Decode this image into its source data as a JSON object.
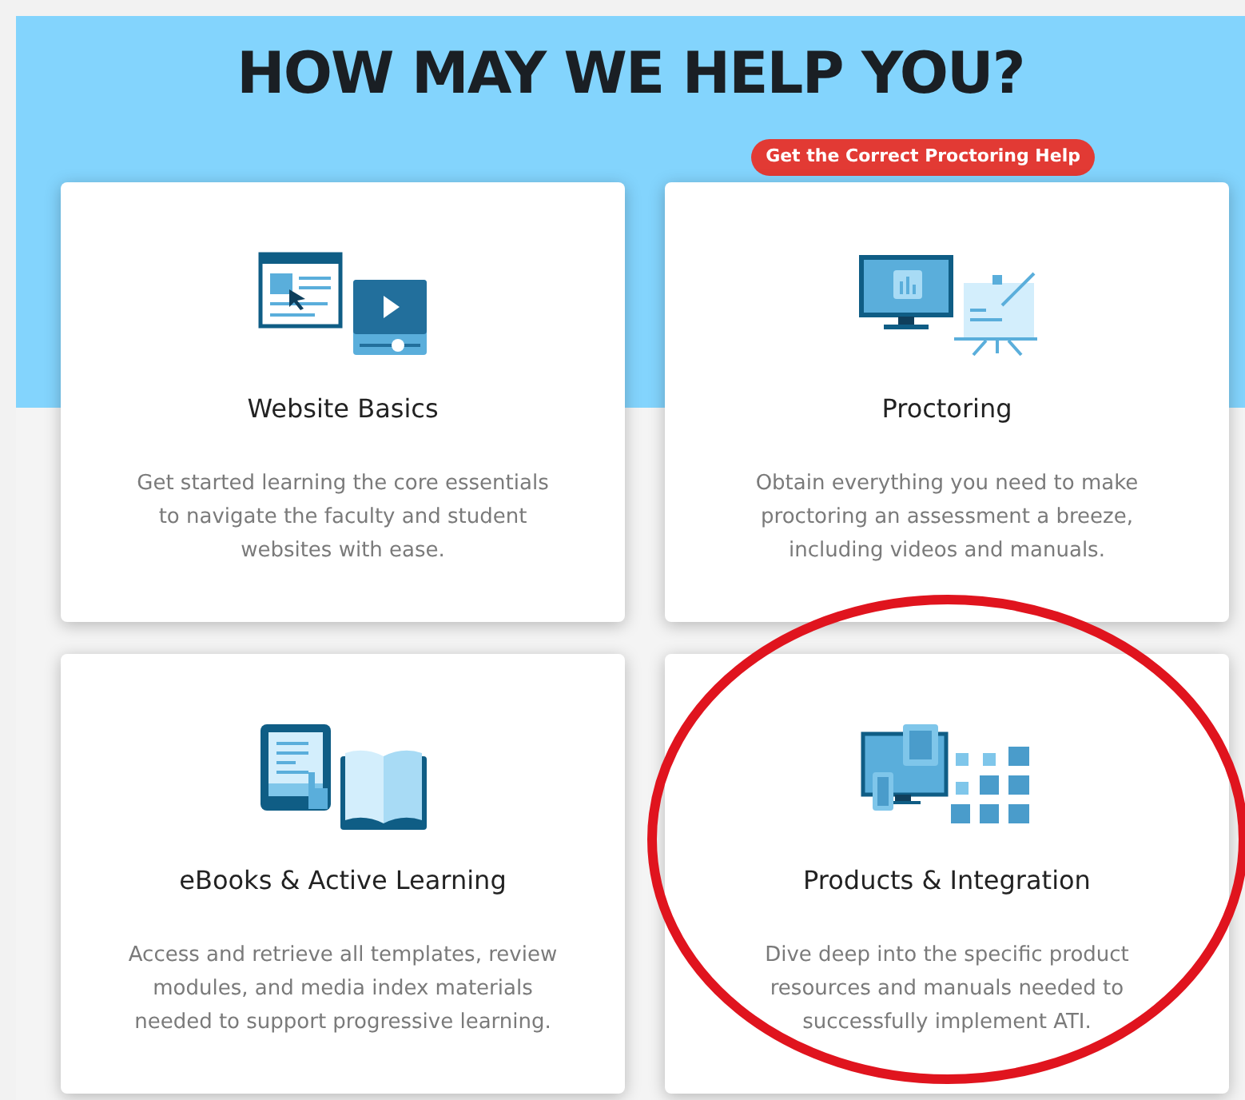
{
  "header": {
    "title": "HOW MAY WE HELP YOU?",
    "badge": "Get the Correct Proctoring Help"
  },
  "cards": [
    {
      "kind": "website",
      "title": "Website Basics",
      "text": "Get started learning the core essentials to navigate the faculty and student websites with ease."
    },
    {
      "kind": "proctoring",
      "title": "Proctoring",
      "text": "Obtain everything you need to make proctoring an assessment a breeze, including videos and manuals."
    },
    {
      "kind": "ebooks",
      "title": "eBooks & Active Learning",
      "text": "Access and retrieve all templates, review modules, and media index materials needed to support progressive learning."
    },
    {
      "kind": "products",
      "title": "Products & Integration",
      "text": "Dive deep into the specific product resources and manuals needed to successfully implement ATI."
    }
  ],
  "annotation": {
    "kind": "ellipse",
    "color": "#e0141e"
  }
}
